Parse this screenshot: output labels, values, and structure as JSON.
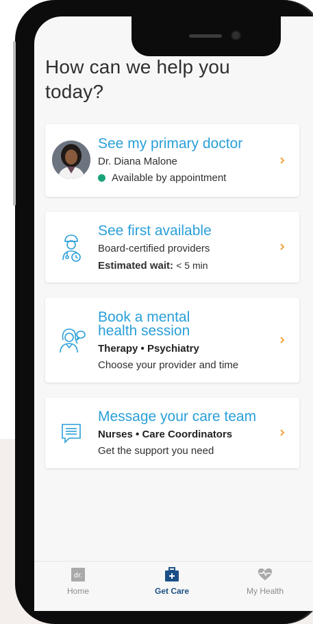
{
  "header": {
    "title": "How can we help you today?"
  },
  "cards": [
    {
      "title": "See my primary doctor",
      "subtitle": "Dr. Diana Malone",
      "status": "Available by appointment",
      "status_color": "#1aa37a"
    },
    {
      "title": "See first available",
      "subtitle": "Board-certified providers",
      "detail_label": "Estimated wait:",
      "detail_value": "< 5 min",
      "icon": "provider-clock-icon"
    },
    {
      "title_line1": "Book a mental",
      "title_line2": "health session",
      "subtitle": "Therapy • Psychiatry",
      "detail": "Choose your provider and time",
      "icon": "provider-chat-icon"
    },
    {
      "title": "Message your care team",
      "subtitle": "Nurses • Care Coordinators",
      "detail": "Get the support you need",
      "icon": "message-icon"
    }
  ],
  "tabbar": {
    "home": {
      "label": "Home",
      "icon": "dr-logo-icon"
    },
    "get_care": {
      "label": "Get Care",
      "icon": "medical-kit-icon"
    },
    "my_health": {
      "label": "My Health",
      "icon": "heart-pulse-icon"
    }
  },
  "colors": {
    "accent": "#2a9fd8",
    "chevron": "#f2a33a",
    "active_tab": "#1b4f86",
    "inactive_tab": "#8c8c8c"
  }
}
